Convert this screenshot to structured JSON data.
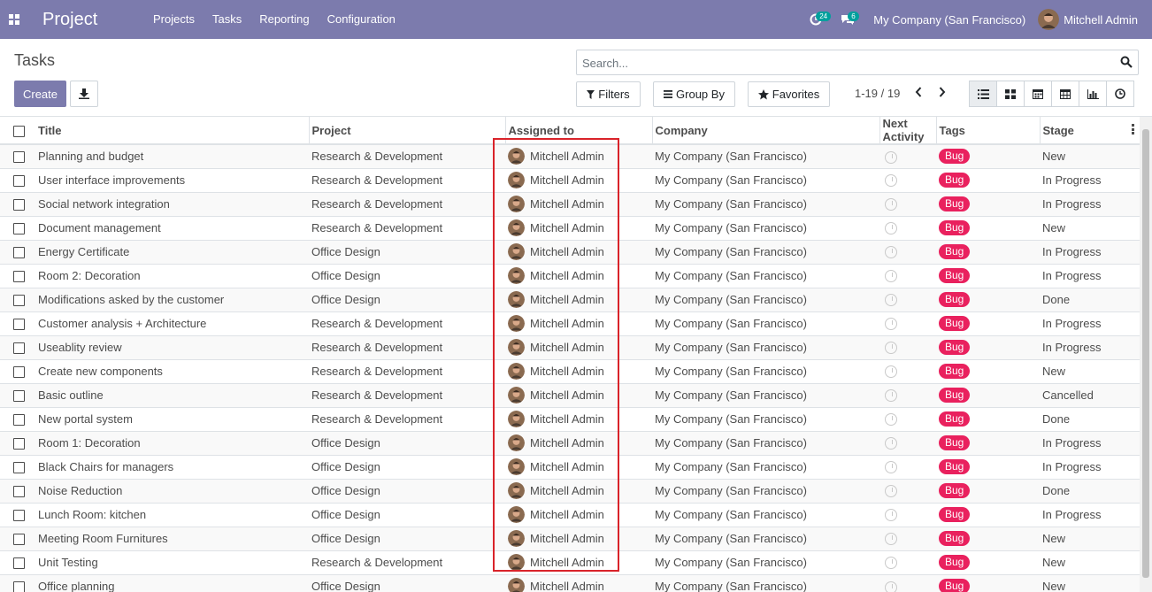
{
  "navbar": {
    "brand": "Project",
    "menu": [
      "Projects",
      "Tasks",
      "Reporting",
      "Configuration"
    ],
    "activity_count": "24",
    "message_count": "6",
    "company": "My Company (San Francisco)",
    "user": "Mitchell Admin",
    "accent_color": "#7c7bad"
  },
  "control_panel": {
    "breadcrumb": "Tasks",
    "create_label": "Create",
    "search_placeholder": "Search...",
    "filters_label": "Filters",
    "groupby_label": "Group By",
    "favorites_label": "Favorites",
    "pager": "1-19 / 19",
    "views": [
      "list-icon",
      "kanban-icon",
      "calendar-icon",
      "pivot-icon",
      "graph-icon",
      "activity-icon"
    ]
  },
  "table": {
    "columns": [
      "Title",
      "Project",
      "Assigned to",
      "Company",
      "Next Activity",
      "Tags",
      "Stage"
    ],
    "rows": [
      {
        "title": "Planning and budget",
        "project": "Research & Development",
        "assignee": "Mitchell Admin",
        "company": "My Company (San Francisco)",
        "tag": "Bug",
        "stage": "New"
      },
      {
        "title": "User interface improvements",
        "project": "Research & Development",
        "assignee": "Mitchell Admin",
        "company": "My Company (San Francisco)",
        "tag": "Bug",
        "stage": "In Progress"
      },
      {
        "title": "Social network integration",
        "project": "Research & Development",
        "assignee": "Mitchell Admin",
        "company": "My Company (San Francisco)",
        "tag": "Bug",
        "stage": "In Progress"
      },
      {
        "title": "Document management",
        "project": "Research & Development",
        "assignee": "Mitchell Admin",
        "company": "My Company (San Francisco)",
        "tag": "Bug",
        "stage": "New"
      },
      {
        "title": "Energy Certificate",
        "project": "Office Design",
        "assignee": "Mitchell Admin",
        "company": "My Company (San Francisco)",
        "tag": "Bug",
        "stage": "In Progress"
      },
      {
        "title": "Room 2: Decoration",
        "project": "Office Design",
        "assignee": "Mitchell Admin",
        "company": "My Company (San Francisco)",
        "tag": "Bug",
        "stage": "In Progress"
      },
      {
        "title": "Modifications asked by the customer",
        "project": "Office Design",
        "assignee": "Mitchell Admin",
        "company": "My Company (San Francisco)",
        "tag": "Bug",
        "stage": "Done"
      },
      {
        "title": "Customer analysis + Architecture",
        "project": "Research & Development",
        "assignee": "Mitchell Admin",
        "company": "My Company (San Francisco)",
        "tag": "Bug",
        "stage": "In Progress"
      },
      {
        "title": "Useablity review",
        "project": "Research & Development",
        "assignee": "Mitchell Admin",
        "company": "My Company (San Francisco)",
        "tag": "Bug",
        "stage": "In Progress"
      },
      {
        "title": "Create new components",
        "project": "Research & Development",
        "assignee": "Mitchell Admin",
        "company": "My Company (San Francisco)",
        "tag": "Bug",
        "stage": "New"
      },
      {
        "title": "Basic outline",
        "project": "Research & Development",
        "assignee": "Mitchell Admin",
        "company": "My Company (San Francisco)",
        "tag": "Bug",
        "stage": "Cancelled"
      },
      {
        "title": "New portal system",
        "project": "Research & Development",
        "assignee": "Mitchell Admin",
        "company": "My Company (San Francisco)",
        "tag": "Bug",
        "stage": "Done"
      },
      {
        "title": "Room 1: Decoration",
        "project": "Office Design",
        "assignee": "Mitchell Admin",
        "company": "My Company (San Francisco)",
        "tag": "Bug",
        "stage": "In Progress"
      },
      {
        "title": "Black Chairs for managers",
        "project": "Office Design",
        "assignee": "Mitchell Admin",
        "company": "My Company (San Francisco)",
        "tag": "Bug",
        "stage": "In Progress"
      },
      {
        "title": "Noise Reduction",
        "project": "Office Design",
        "assignee": "Mitchell Admin",
        "company": "My Company (San Francisco)",
        "tag": "Bug",
        "stage": "Done"
      },
      {
        "title": "Lunch Room: kitchen",
        "project": "Office Design",
        "assignee": "Mitchell Admin",
        "company": "My Company (San Francisco)",
        "tag": "Bug",
        "stage": "In Progress"
      },
      {
        "title": "Meeting Room Furnitures",
        "project": "Office Design",
        "assignee": "Mitchell Admin",
        "company": "My Company (San Francisco)",
        "tag": "Bug",
        "stage": "New"
      },
      {
        "title": "Unit Testing",
        "project": "Research & Development",
        "assignee": "Mitchell Admin",
        "company": "My Company (San Francisco)",
        "tag": "Bug",
        "stage": "New"
      },
      {
        "title": "Office planning",
        "project": "Office Design",
        "assignee": "Mitchell Admin",
        "company": "My Company (San Francisco)",
        "tag": "Bug",
        "stage": "New"
      }
    ]
  }
}
